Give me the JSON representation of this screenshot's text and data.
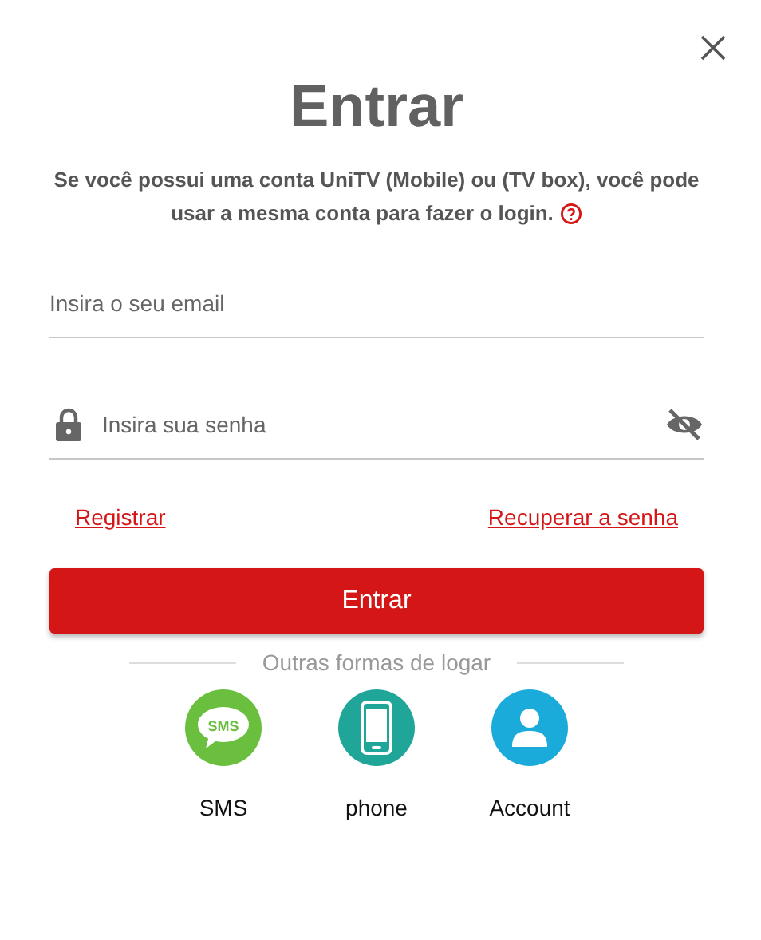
{
  "title": "Entrar",
  "description": "Se você possui uma conta UniTV (Mobile) ou (TV box), você pode usar a mesma conta para fazer o login.",
  "email_field": {
    "placeholder": "Insira o seu email"
  },
  "password_field": {
    "placeholder": "Insira sua senha",
    "visible": false
  },
  "links": [
    "Registrar",
    "Recuperar a senha"
  ],
  "submit_button": "Entrar",
  "divider_text": "Outras formas de logar",
  "methods": [
    {
      "kind": "sms",
      "label": "SMS",
      "icon_text": "SMS",
      "color": "#6abf3f"
    },
    {
      "kind": "phone",
      "label": "phone",
      "color": "#1fa698"
    },
    {
      "kind": "account",
      "label": "Account",
      "color": "#1aabdb"
    }
  ]
}
